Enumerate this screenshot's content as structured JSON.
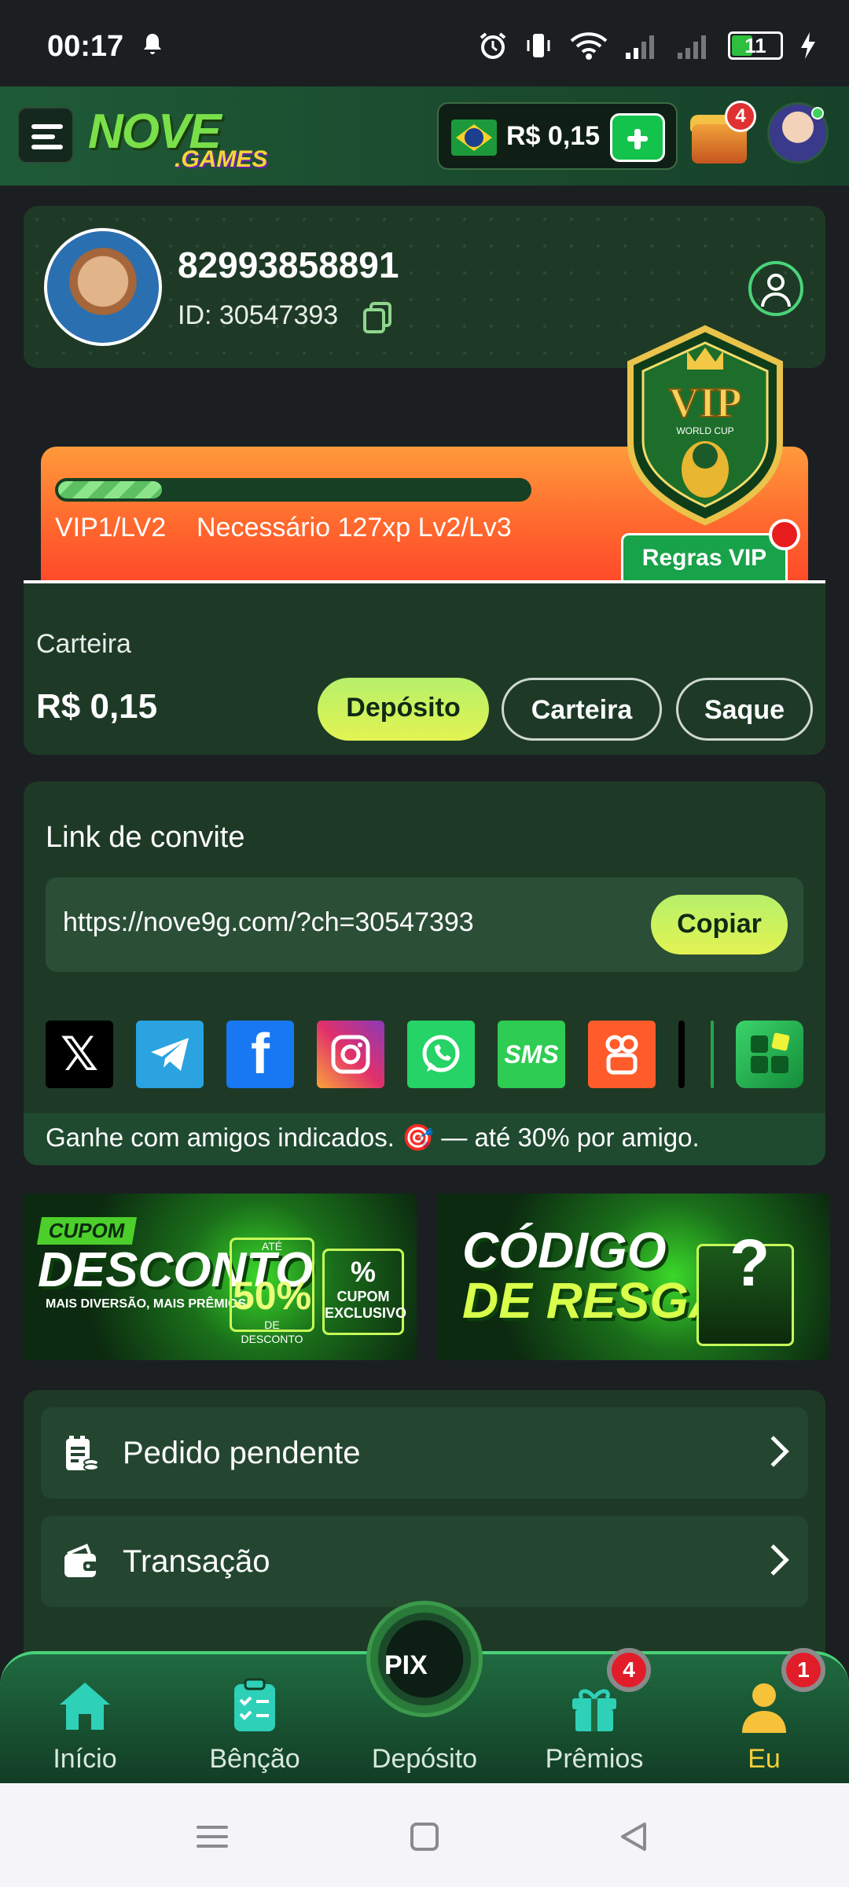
{
  "status_bar": {
    "time": "00:17",
    "battery": "11"
  },
  "header": {
    "logo_main": "NOVE",
    "logo_sub": ".GAMES",
    "balance": "R$ 0,15",
    "chest_badge": "4"
  },
  "profile": {
    "name": "82993858891",
    "id_label": "ID: 30547393"
  },
  "vip": {
    "progress_fraction": 0.22,
    "level": "VIP1/LV2",
    "requirement": "Necessário 127xp Lv2/Lv3",
    "rules_label": "Regras VIP",
    "badge_title": "VIP",
    "badge_sub": "WORLD CUP"
  },
  "wallet": {
    "title": "Carteira",
    "amount": "R$ 0,15",
    "deposit_label": "Depósito",
    "wallet_label": "Carteira",
    "withdraw_label": "Saque"
  },
  "invite": {
    "title": "Link de convite",
    "url": "https://nove9g.com/?ch=30547393",
    "copy_label": "Copiar",
    "share_sms_label": "SMS",
    "footer": "Ganhe com amigos indicados. 🎯 — até 30% por amigo."
  },
  "banners": {
    "discount_tag": "CUPOM",
    "discount_title": "DESCONTO",
    "discount_sub": "MAIS DIVERSÃO, MAIS PRÊMIOS!",
    "discount_pct": "50%",
    "discount_pct_sub": "DE DESCONTO",
    "discount_pct_top": "ATÉ",
    "discount_coupon": "CUPOM EXCLUSIVO",
    "redeem_title_1": "CÓDIGO",
    "redeem_title_2": "DE RESGATE"
  },
  "menu": {
    "items": [
      {
        "label": "Pedido pendente"
      },
      {
        "label": "Transação"
      }
    ]
  },
  "bottom_nav": {
    "items": [
      {
        "label": "Início"
      },
      {
        "label": "Bênção"
      },
      {
        "label": "Depósito"
      },
      {
        "label": "Prêmios",
        "badge": "4"
      },
      {
        "label": "Eu",
        "badge": "1"
      }
    ],
    "deposit_coin": "PIX",
    "active_color": "#f5d03a"
  },
  "colors": {
    "accent_green": "#13c34c",
    "card_bg": "#1e3a27",
    "vip_orange": "#ff6a2e"
  }
}
